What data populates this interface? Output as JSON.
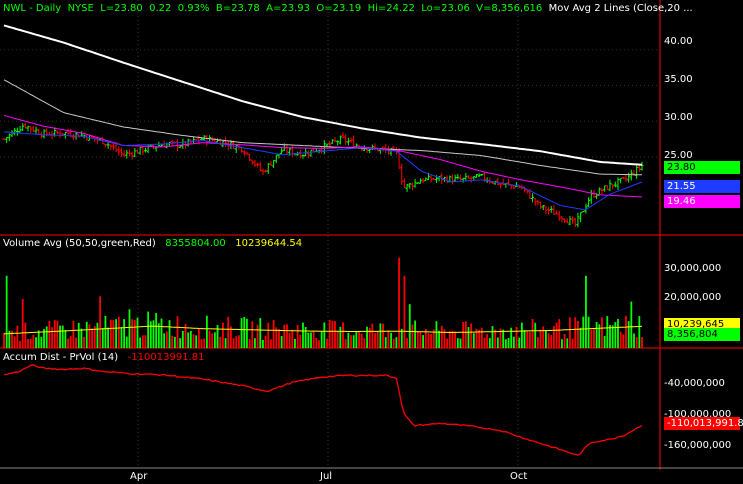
{
  "header": {
    "symbol": "NWL - Daily",
    "exchange": "NYSE",
    "last": "L=23.80",
    "change": "0.22",
    "change_pct": "0.93%",
    "bid": "B=23.78",
    "ask": "A=23.93",
    "open": "O=23.19",
    "high": "Hi=24.22",
    "low": "Lo=23.06",
    "volume": "V=8,356,616",
    "study": "Mov Avg 2 Lines (Close,20 ..."
  },
  "volume_panel": {
    "title": "Volume Avg (50,50,green,Red)",
    "value1": "8355804.00",
    "value2": "10239644.54",
    "axis": [
      "30,000,000",
      "20,000,000"
    ],
    "last_label": "8,356,804",
    "avg_label": "10,239,645"
  },
  "accum_panel": {
    "title": "Accum Dist - PrVol (14)",
    "value": "-110013991.81",
    "axis": [
      "-40,000,000",
      "-100,000,000",
      "-160,000,000"
    ],
    "last_label": "-110,013,991.81"
  },
  "price_axis": [
    "40.00",
    "35.00",
    "30.00",
    "25.00"
  ],
  "price_labels": {
    "last": "23.80",
    "ma_blue": "21.55",
    "ma_magenta": "19.46"
  },
  "x_axis": [
    "Apr",
    "Jul",
    "Oct"
  ],
  "colors": {
    "up": "#00ff00",
    "down": "#ff0000",
    "ma_white": "#ffffff",
    "ma_gray": "#c8c8c8",
    "ma_magenta": "#ff00ff",
    "ma_blue": "#1e3cff",
    "vol_avg": "#ffff00",
    "accum": "#ff0000",
    "divider": "#ff0000"
  },
  "chart_data": {
    "type": "line",
    "x_labels": [
      "Apr",
      "Jul",
      "Oct"
    ],
    "price_ylim": [
      14.5,
      45
    ],
    "price_close_anchors": [
      [
        0,
        27.5
      ],
      [
        20,
        29.5
      ],
      [
        40,
        28.2
      ],
      [
        60,
        28.4
      ],
      [
        80,
        28.0
      ],
      [
        100,
        27.2
      ],
      [
        120,
        25.3
      ],
      [
        140,
        26.0
      ],
      [
        160,
        26.8
      ],
      [
        180,
        26.7
      ],
      [
        200,
        27.6
      ],
      [
        220,
        27.1
      ],
      [
        240,
        26.2
      ],
      [
        260,
        22.8
      ],
      [
        280,
        26.0
      ],
      [
        300,
        25.4
      ],
      [
        320,
        26.3
      ],
      [
        340,
        27.5
      ],
      [
        360,
        26.4
      ],
      [
        380,
        26.0
      ],
      [
        395,
        25.6
      ],
      [
        402,
        20.7
      ],
      [
        420,
        21.8
      ],
      [
        440,
        22.0
      ],
      [
        460,
        21.8
      ],
      [
        480,
        22.2
      ],
      [
        500,
        21.2
      ],
      [
        520,
        20.8
      ],
      [
        540,
        18.0
      ],
      [
        560,
        16.8
      ],
      [
        575,
        15.5
      ],
      [
        590,
        19.5
      ],
      [
        610,
        21.0
      ],
      [
        625,
        21.8
      ],
      [
        642,
        23.8
      ]
    ],
    "ma_white_anchors": [
      [
        0,
        43.4
      ],
      [
        60,
        41.0
      ],
      [
        120,
        38.2
      ],
      [
        180,
        35.5
      ],
      [
        240,
        32.8
      ],
      [
        300,
        30.6
      ],
      [
        360,
        29.0
      ],
      [
        420,
        27.7
      ],
      [
        480,
        26.8
      ],
      [
        540,
        25.8
      ],
      [
        600,
        24.3
      ],
      [
        642,
        23.9
      ]
    ],
    "ma_gray_anchors": [
      [
        0,
        35.8
      ],
      [
        60,
        31.2
      ],
      [
        120,
        29.2
      ],
      [
        180,
        28.0
      ],
      [
        240,
        27.0
      ],
      [
        300,
        26.6
      ],
      [
        360,
        26.2
      ],
      [
        420,
        25.9
      ],
      [
        480,
        25.2
      ],
      [
        540,
        23.8
      ],
      [
        600,
        22.6
      ],
      [
        642,
        22.5
      ]
    ],
    "ma_magenta_anchors": [
      [
        0,
        30.8
      ],
      [
        40,
        29.3
      ],
      [
        80,
        28.3
      ],
      [
        120,
        26.6
      ],
      [
        160,
        26.4
      ],
      [
        200,
        27.0
      ],
      [
        240,
        26.7
      ],
      [
        280,
        26.3
      ],
      [
        320,
        26.2
      ],
      [
        360,
        26.4
      ],
      [
        400,
        25.8
      ],
      [
        440,
        24.6
      ],
      [
        480,
        23.0
      ],
      [
        520,
        21.8
      ],
      [
        560,
        20.8
      ],
      [
        600,
        19.7
      ],
      [
        642,
        19.4
      ]
    ],
    "ma_blue_anchors": [
      [
        0,
        28.5
      ],
      [
        40,
        28.1
      ],
      [
        80,
        27.9
      ],
      [
        120,
        26.6
      ],
      [
        160,
        26.8
      ],
      [
        200,
        27.3
      ],
      [
        240,
        26.3
      ],
      [
        280,
        25.3
      ],
      [
        320,
        25.8
      ],
      [
        360,
        26.3
      ],
      [
        395,
        25.8
      ],
      [
        420,
        23.0
      ],
      [
        450,
        21.5
      ],
      [
        480,
        21.8
      ],
      [
        520,
        20.9
      ],
      [
        560,
        18.2
      ],
      [
        585,
        17.6
      ],
      [
        610,
        19.8
      ],
      [
        642,
        21.5
      ]
    ],
    "volume_ylim": [
      0,
      38000000
    ],
    "volume_avg_anchors": [
      [
        0,
        5500000
      ],
      [
        60,
        6600000
      ],
      [
        150,
        8500000
      ],
      [
        200,
        7500000
      ],
      [
        300,
        6600000
      ],
      [
        350,
        6400000
      ],
      [
        400,
        6500000
      ],
      [
        450,
        6000000
      ],
      [
        550,
        6800000
      ],
      [
        642,
        8400000
      ]
    ],
    "volume_spikes": [
      [
        3,
        28000000,
        "up"
      ],
      [
        18,
        19000000,
        "down"
      ],
      [
        97,
        20000000,
        "down"
      ],
      [
        126,
        15000000,
        "up"
      ],
      [
        398,
        35000000,
        "down"
      ],
      [
        403,
        28000000,
        "down"
      ],
      [
        408,
        17000000,
        "up"
      ],
      [
        585,
        28000000,
        "up"
      ],
      [
        632,
        18000000,
        "up"
      ]
    ],
    "accum_ylim": [
      -185000000,
      0
    ],
    "accum_anchors": [
      [
        0,
        -18000000
      ],
      [
        15,
        -12000000
      ],
      [
        28,
        0
      ],
      [
        40,
        -6000000
      ],
      [
        60,
        -8000000
      ],
      [
        80,
        -6000000
      ],
      [
        100,
        -12000000
      ],
      [
        130,
        -16000000
      ],
      [
        160,
        -18000000
      ],
      [
        200,
        -26000000
      ],
      [
        240,
        -38000000
      ],
      [
        265,
        -48000000
      ],
      [
        290,
        -32000000
      ],
      [
        320,
        -22000000
      ],
      [
        345,
        -19000000
      ],
      [
        385,
        -19000000
      ],
      [
        395,
        -24000000
      ],
      [
        402,
        -88000000
      ],
      [
        412,
        -111000000
      ],
      [
        440,
        -107000000
      ],
      [
        470,
        -112000000
      ],
      [
        500,
        -120000000
      ],
      [
        530,
        -138000000
      ],
      [
        560,
        -155000000
      ],
      [
        578,
        -166000000
      ],
      [
        590,
        -142000000
      ],
      [
        610,
        -136000000
      ],
      [
        625,
        -128000000
      ],
      [
        642,
        -110000000
      ]
    ]
  }
}
